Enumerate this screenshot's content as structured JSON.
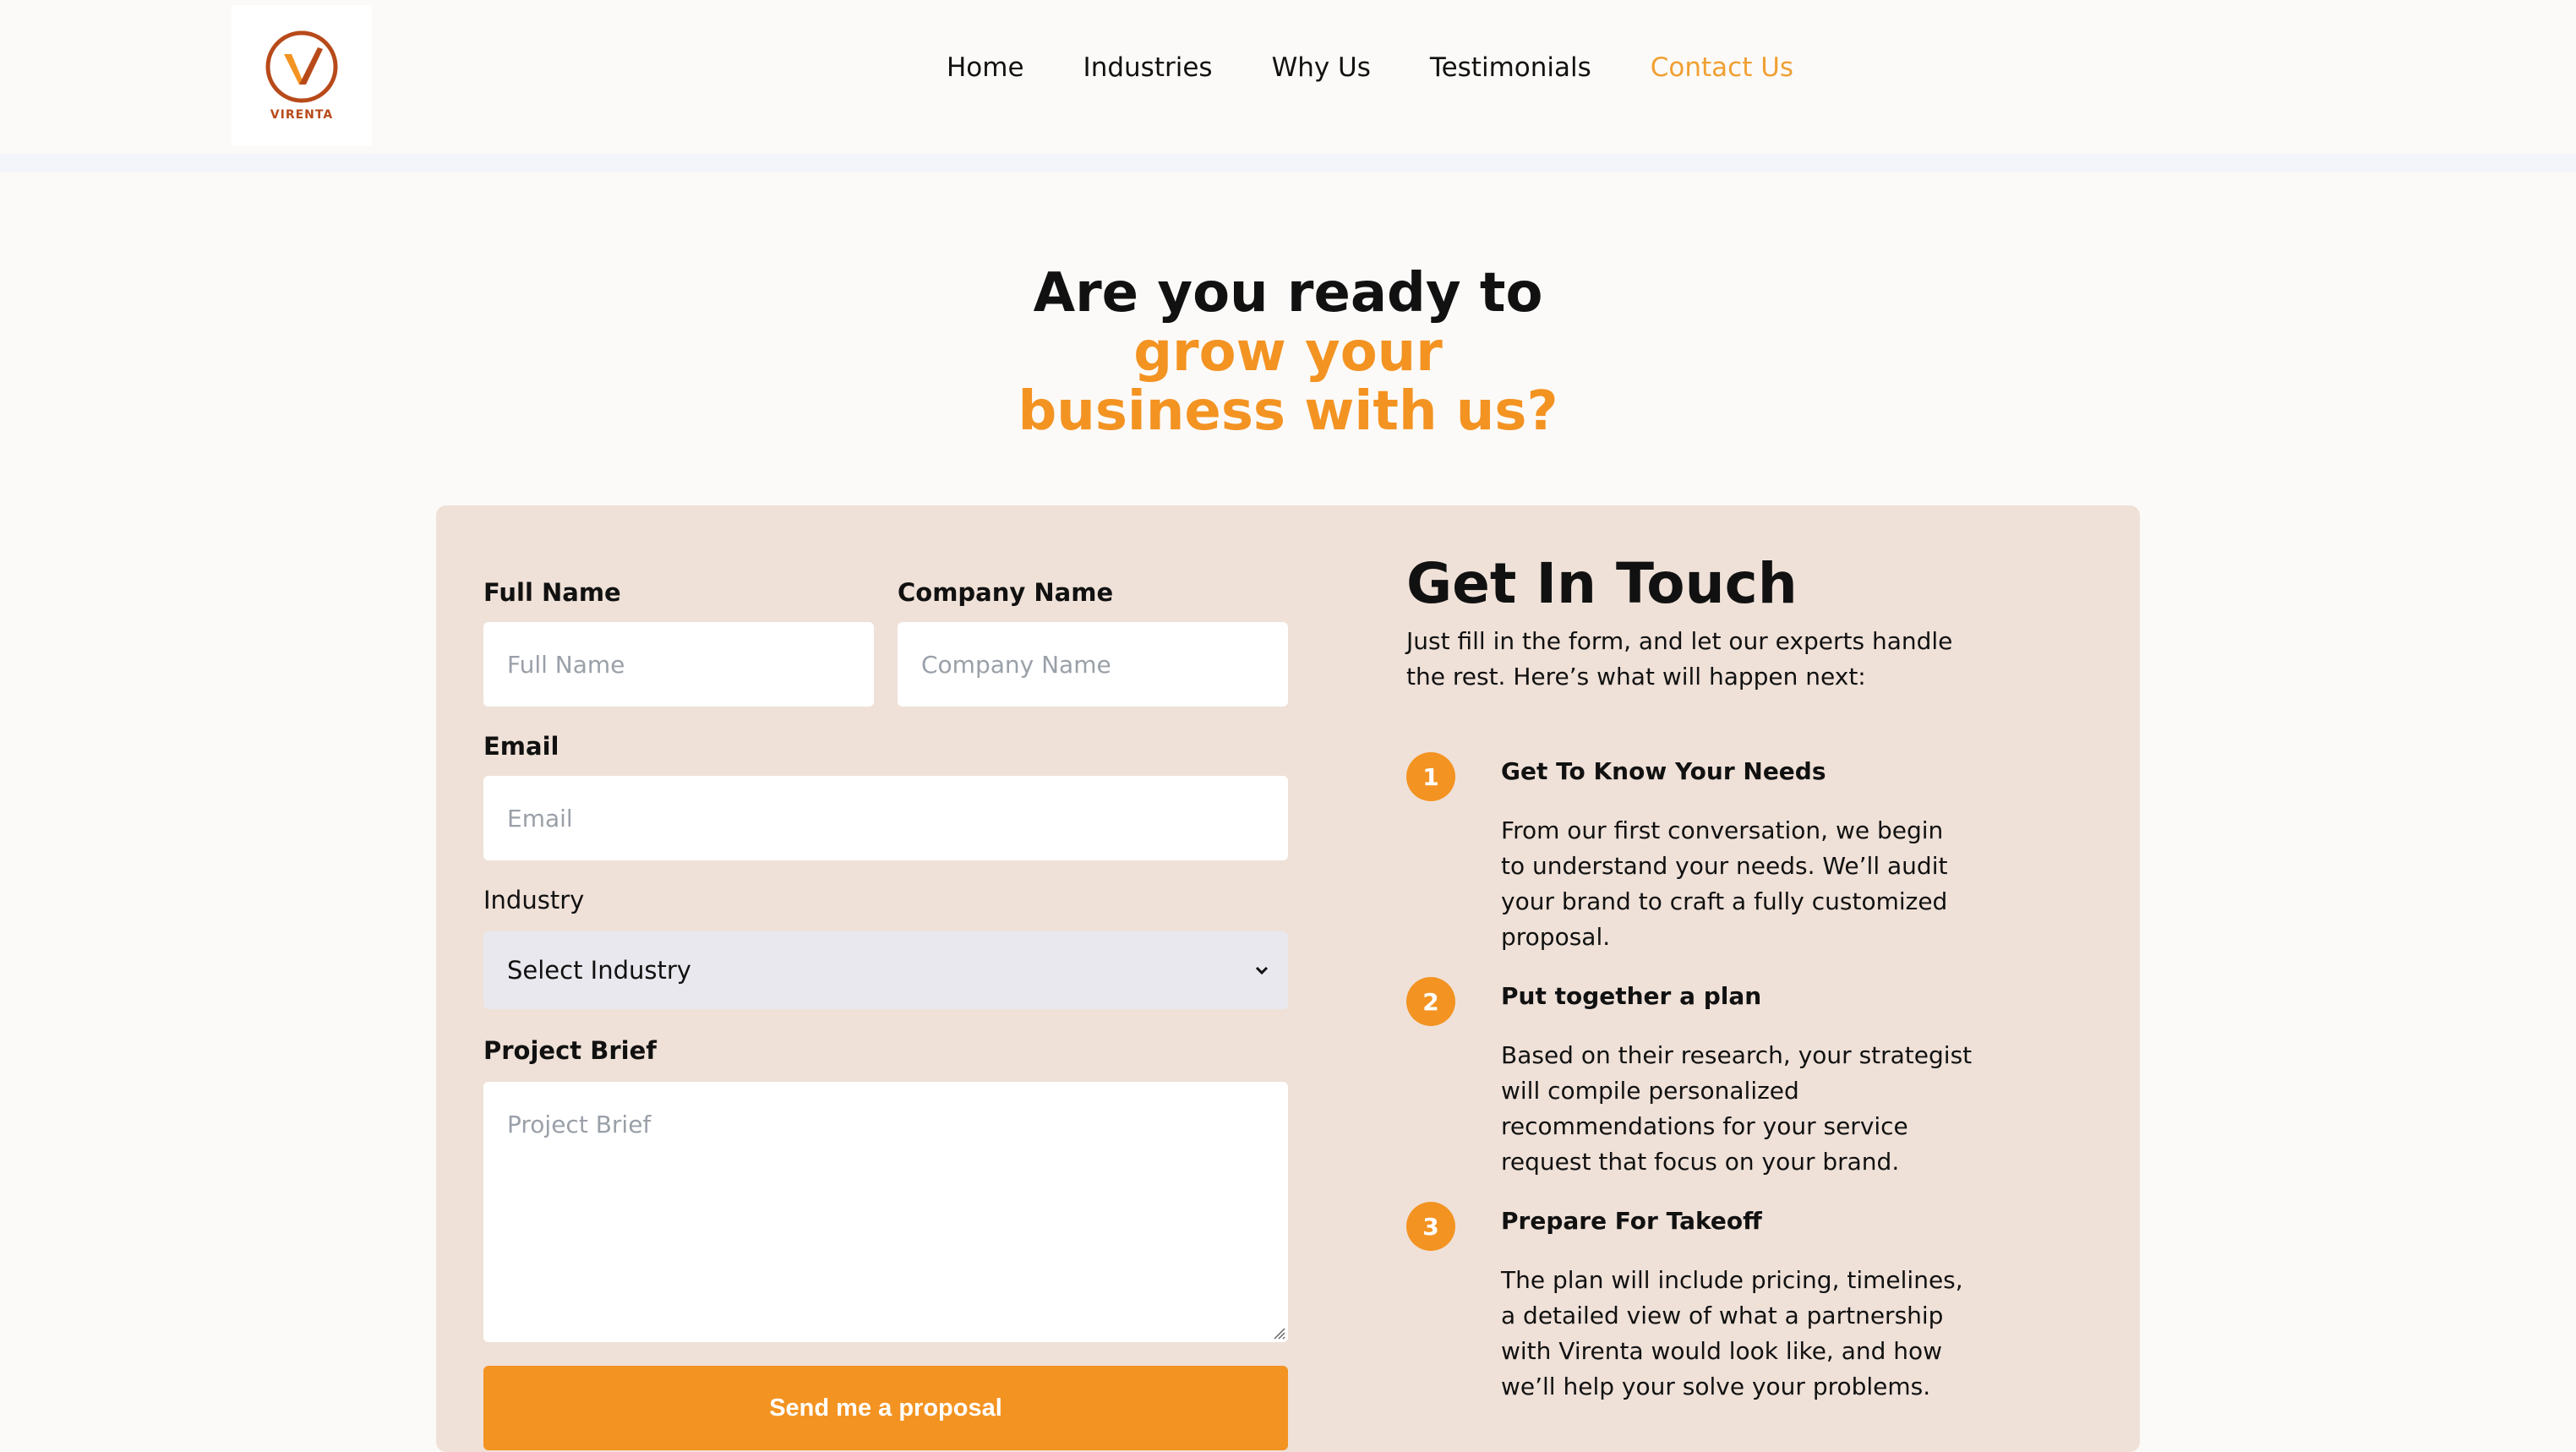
{
  "brand": {
    "logo_text": "VIRENTA",
    "accent_color": "#f39322",
    "logo_icon": "v-check-logo-icon"
  },
  "nav": {
    "items": [
      {
        "label": "Home"
      },
      {
        "label": "Industries"
      },
      {
        "label": "Why Us"
      },
      {
        "label": "Testimonials"
      },
      {
        "label": "Contact Us",
        "active": true
      }
    ]
  },
  "hero": {
    "line1": "Are you ready to",
    "line2": "grow your",
    "line3": "business with us?"
  },
  "form": {
    "full_name": {
      "label": "Full Name",
      "placeholder": "Full Name",
      "value": ""
    },
    "company_name": {
      "label": "Company Name",
      "placeholder": "Company Name",
      "value": ""
    },
    "email": {
      "label": "Email",
      "placeholder": "Email",
      "value": ""
    },
    "industry": {
      "label": "Industry",
      "selected": "Select Industry"
    },
    "project_brief": {
      "label": "Project Brief",
      "placeholder": "Project Brief",
      "value": ""
    },
    "submit_label": "Send me a proposal"
  },
  "get_in_touch": {
    "title": "Get In Touch",
    "intro": "Just fill in the form, and let our experts handle the rest. Here’s what will happen next:",
    "steps": [
      {
        "num": "1",
        "title": "Get To Know Your Needs",
        "body": "From our first conversation, we begin to understand your needs. We’ll audit your brand to craft a fully customized proposal."
      },
      {
        "num": "2",
        "title": "Put together a plan",
        "body": "Based on their research, your strategist will compile personalized recommendations for your service request that focus on your brand."
      },
      {
        "num": "3",
        "title": "Prepare For Takeoff",
        "body": "The plan will include pricing, timelines, a detailed view of what a partnership with Virenta would look like, and how we’ll help your solve your problems."
      }
    ]
  }
}
